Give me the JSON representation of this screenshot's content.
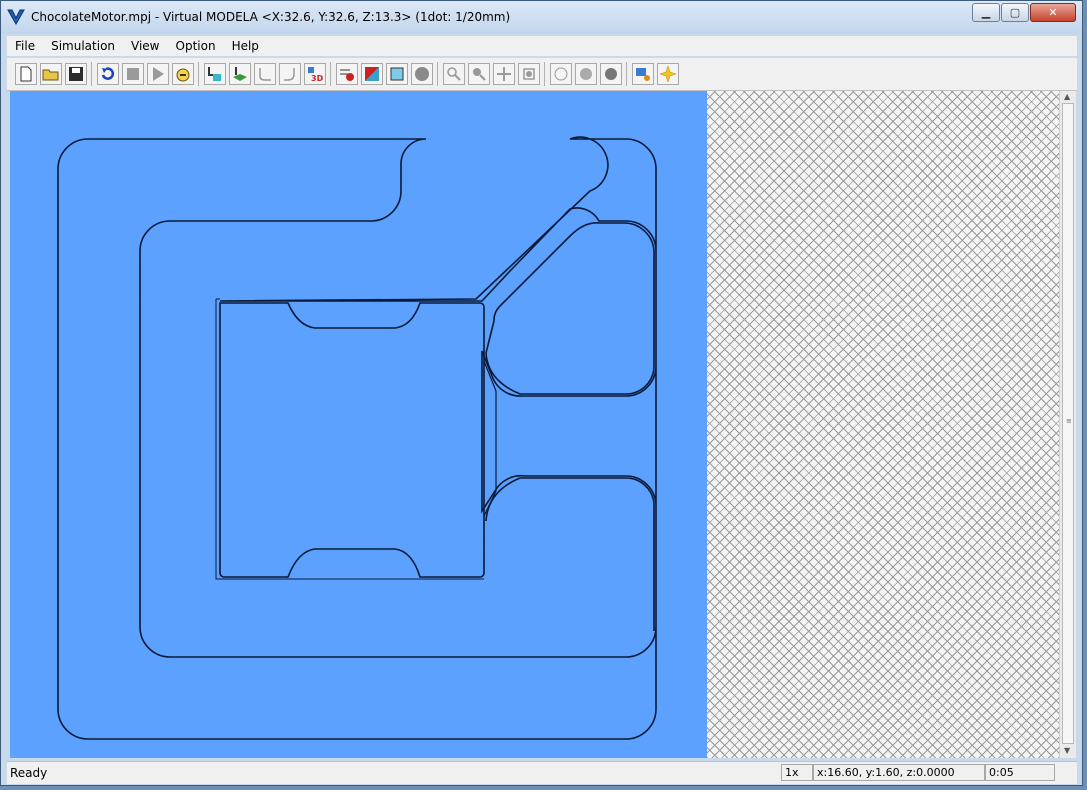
{
  "window": {
    "title": "ChocolateMotor.mpj - Virtual MODELA <X:32.6, Y:32.6, Z:13.3> (1dot: 1/20mm)",
    "app_icon": "modela-v-icon",
    "controls": {
      "minimize": "minimize-icon",
      "maximize": "maximize-icon",
      "close": "close-icon"
    }
  },
  "menu": [
    "File",
    "Simulation",
    "View",
    "Option",
    "Help"
  ],
  "toolbar": [
    {
      "name": "new-file-icon"
    },
    {
      "name": "open-folder-icon"
    },
    {
      "name": "save-icon"
    },
    {
      "name": "reset-icon"
    },
    {
      "name": "stop-icon"
    },
    {
      "name": "play-icon"
    },
    {
      "name": "step-icon"
    },
    {
      "name": "tool-front-icon"
    },
    {
      "name": "tool-side-icon"
    },
    {
      "name": "path-in-icon"
    },
    {
      "name": "path-out-icon"
    },
    {
      "name": "3d-view-icon",
      "label": "3D"
    },
    {
      "name": "render-mode-icon"
    },
    {
      "name": "shade-icon"
    },
    {
      "name": "wireframe-icon"
    },
    {
      "name": "sphere-icon"
    },
    {
      "name": "zoom-in-icon"
    },
    {
      "name": "zoom-out-icon"
    },
    {
      "name": "pan-icon"
    },
    {
      "name": "fit-icon"
    },
    {
      "name": "light-off-icon"
    },
    {
      "name": "light-gray-icon"
    },
    {
      "name": "light-dark-icon"
    },
    {
      "name": "material-icon"
    },
    {
      "name": "sparkle-icon"
    }
  ],
  "colors": {
    "material": "#5ba1fd",
    "accent": "#cc2222"
  },
  "status": {
    "text": "Ready",
    "zoom": "1x",
    "coords": "x:16.60, y:1.60, z:0.0000",
    "time": "0:05"
  }
}
